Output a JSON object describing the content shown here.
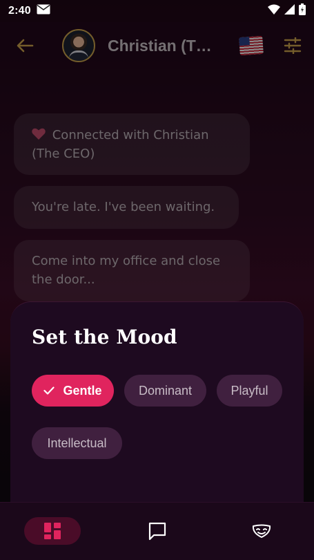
{
  "status_bar": {
    "time": "2:40"
  },
  "header": {
    "contact_name": "Christian (The CEO)"
  },
  "messages": [
    {
      "text": "Connected with Christian (The CEO)",
      "icon": "heart-icon"
    },
    {
      "text": "You're late. I've been waiting."
    },
    {
      "text": "Come into my office and close the door..."
    }
  ],
  "mood_sheet": {
    "title": "Set the Mood",
    "options": [
      {
        "label": "Gentle",
        "selected": true
      },
      {
        "label": "Dominant",
        "selected": false
      },
      {
        "label": "Playful",
        "selected": false
      },
      {
        "label": "Intellectual",
        "selected": false
      }
    ]
  },
  "nav": {
    "items": [
      {
        "name": "dashboard",
        "icon": "dashboard-icon",
        "active": true
      },
      {
        "name": "chat",
        "icon": "chat-bubble-icon",
        "active": false
      },
      {
        "name": "masks",
        "icon": "masks-icon",
        "active": false
      }
    ]
  },
  "colors": {
    "accent": "#e0245e",
    "gold": "#c9a14a",
    "sheet_bg": "#1e0a20",
    "chip_bg": "#40203f"
  }
}
